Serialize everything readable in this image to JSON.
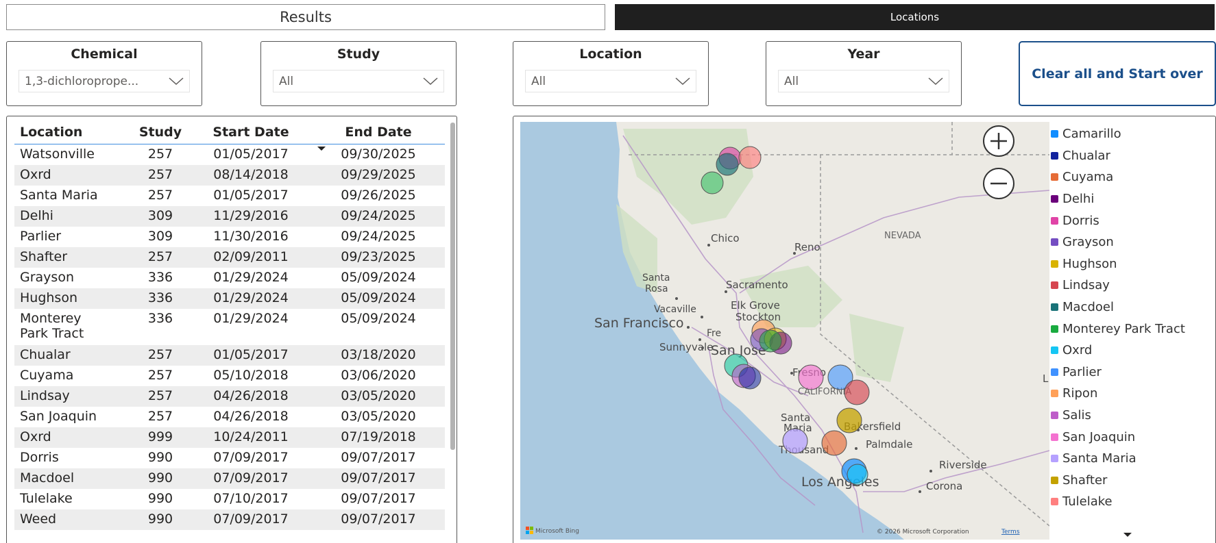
{
  "tabs": {
    "results": "Results",
    "locations": "Locations"
  },
  "slicers": [
    {
      "title": "Chemical",
      "value": "1,3-dichloroprope..."
    },
    {
      "title": "Study",
      "value": "All"
    },
    {
      "title": "Location",
      "value": "All"
    },
    {
      "title": "Year",
      "value": "All"
    }
  ],
  "clear_button": "Clear all and Start over",
  "table": {
    "headers": [
      "Location",
      "Study",
      "Start Date",
      "End Date"
    ],
    "rows": [
      [
        "Watsonville",
        "257",
        "01/05/2017",
        "09/30/2025"
      ],
      [
        "Oxrd",
        "257",
        "08/14/2018",
        "09/29/2025"
      ],
      [
        "Santa Maria",
        "257",
        "01/05/2017",
        "09/26/2025"
      ],
      [
        "Delhi",
        "309",
        "11/29/2016",
        "09/24/2025"
      ],
      [
        "Parlier",
        "309",
        "11/30/2016",
        "09/24/2025"
      ],
      [
        "Shafter",
        "257",
        "02/09/2011",
        "09/23/2025"
      ],
      [
        "Grayson",
        "336",
        "01/29/2024",
        "05/09/2024"
      ],
      [
        "Hughson",
        "336",
        "01/29/2024",
        "05/09/2024"
      ],
      [
        "Monterey Park Tract",
        "336",
        "01/29/2024",
        "05/09/2024"
      ],
      [
        "Chualar",
        "257",
        "01/05/2017",
        "03/18/2020"
      ],
      [
        "Cuyama",
        "257",
        "05/10/2018",
        "03/06/2020"
      ],
      [
        "Lindsay",
        "257",
        "04/26/2018",
        "03/05/2020"
      ],
      [
        "San Joaquin",
        "257",
        "04/26/2018",
        "03/05/2020"
      ],
      [
        "Oxrd",
        "999",
        "10/24/2011",
        "07/19/2018"
      ],
      [
        "Dorris",
        "990",
        "07/09/2017",
        "09/07/2017"
      ],
      [
        "Macdoel",
        "990",
        "07/09/2017",
        "09/07/2017"
      ],
      [
        "Tulelake",
        "990",
        "07/10/2017",
        "09/07/2017"
      ],
      [
        "Weed",
        "990",
        "07/09/2017",
        "09/07/2017"
      ]
    ]
  },
  "map": {
    "labels": {
      "chico": "Chico",
      "reno": "Reno",
      "nevada": "NEVADA",
      "santa_rosa": "Santa\nRosa",
      "sacramento": "Sacramento",
      "vacaville": "Vacaville",
      "elk_grove": "Elk Grove",
      "stockton": "Stockton",
      "san_francisco": "San Francisco",
      "fremont": "Fre",
      "sunnyvale": "Sunnyvale",
      "san_jose": "San Jose",
      "fresno": "Fresno",
      "california": "CALIFORNIA",
      "santa_maria": "Santa\nMaria",
      "bakersfield": "Bakersfield",
      "palmdale": "Palmdale",
      "thousand_oaks": "Thousand",
      "riverside": "Riverside",
      "los_angeles": "Los Angeles",
      "corona": "Corona",
      "l_edge": "L"
    },
    "attribution": "Microsoft Bing",
    "copyright": "© 2026 Microsoft Corporation",
    "terms": "Terms"
  },
  "legend": [
    {
      "name": "Camarillo",
      "color": "#118dff"
    },
    {
      "name": "Chualar",
      "color": "#12239e"
    },
    {
      "name": "Cuyama",
      "color": "#e66c37"
    },
    {
      "name": "Delhi",
      "color": "#6b007b"
    },
    {
      "name": "Dorris",
      "color": "#e044a7"
    },
    {
      "name": "Grayson",
      "color": "#744ec2"
    },
    {
      "name": "Hughson",
      "color": "#d9b300"
    },
    {
      "name": "Lindsay",
      "color": "#d64550"
    },
    {
      "name": "Macdoel",
      "color": "#197278"
    },
    {
      "name": "Monterey Park Tract",
      "color": "#1aab40"
    },
    {
      "name": "Oxrd",
      "color": "#15c6f4"
    },
    {
      "name": "Parlier",
      "color": "#4092ff"
    },
    {
      "name": "Ripon",
      "color": "#ffa058"
    },
    {
      "name": "Salis",
      "color": "#be5dc9"
    },
    {
      "name": "San Joaquin",
      "color": "#f472d0"
    },
    {
      "name": "Santa Maria",
      "color": "#b5a1ff"
    },
    {
      "name": "Shafter",
      "color": "#c4a200"
    },
    {
      "name": "Tulelake",
      "color": "#ff8080"
    }
  ]
}
